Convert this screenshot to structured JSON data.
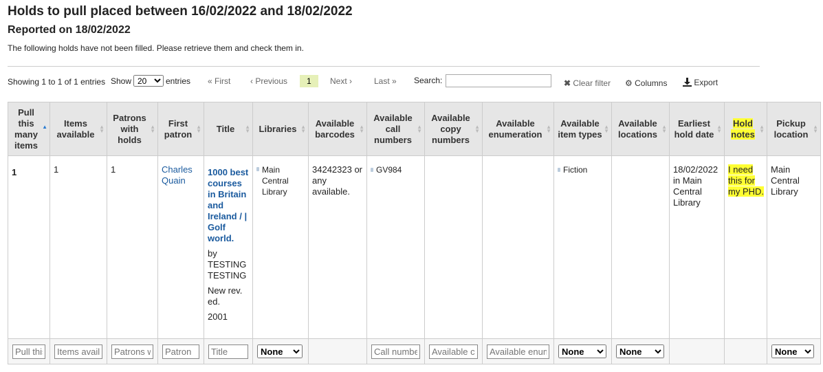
{
  "header": {
    "title": "Holds to pull placed between 16/02/2022 and 18/02/2022",
    "reported": "Reported on 18/02/2022",
    "description": "The following holds have not been filled. Please retrieve them and check them in."
  },
  "toolbar": {
    "showing": "Showing 1 to 1 of 1 entries",
    "show_label": "Show",
    "page_size": "20",
    "entries_label": "entries",
    "first": "« First",
    "previous": "‹ Previous",
    "current_page": "1",
    "next": "Next ›",
    "last": "Last »",
    "search_label": "Search:",
    "search_value": "",
    "clear_filter": "Clear filter",
    "columns": "Columns",
    "export": "Export"
  },
  "columns": [
    "Pull this many items",
    "Items available",
    "Patrons with holds",
    "First patron",
    "Title",
    "Libraries",
    "Available barcodes",
    "Available call numbers",
    "Available copy numbers",
    "Available enumeration",
    "Available item types",
    "Available locations",
    "Earliest hold date",
    "Hold notes",
    "Pickup location"
  ],
  "row": {
    "pull": "1",
    "items_available": "1",
    "patrons_with_holds": "1",
    "first_patron": "Charles Quain",
    "title": "1000 best courses in Britain and Ireland / | Golf world.",
    "author": "by TESTING TESTING",
    "edition": "New rev. ed.",
    "year": "2001",
    "library": "Main Central Library",
    "barcodes": "34242323 or any available.",
    "call_number": "GV984",
    "copy_numbers": "",
    "enumeration": "",
    "item_type": "Fiction",
    "locations": "",
    "earliest_hold": "18/02/2022 in Main Central Library",
    "hold_notes": "I need this for my PHD.",
    "pickup_location": "Main Central Library"
  },
  "filters": {
    "pull": "Pull this many items",
    "items": "Items available",
    "patrons": "Patrons with holds",
    "patron": "Patron",
    "title": "Title",
    "libraries": "None",
    "call": "Call number",
    "copy": "Available copy",
    "enum": "Available enumeration",
    "itemtypes": "None",
    "locations": "None",
    "pickup": "None"
  },
  "colors": {
    "link": "#1a5a9e",
    "highlight": "#ffff33",
    "header_bg": "#e6e6e6"
  }
}
